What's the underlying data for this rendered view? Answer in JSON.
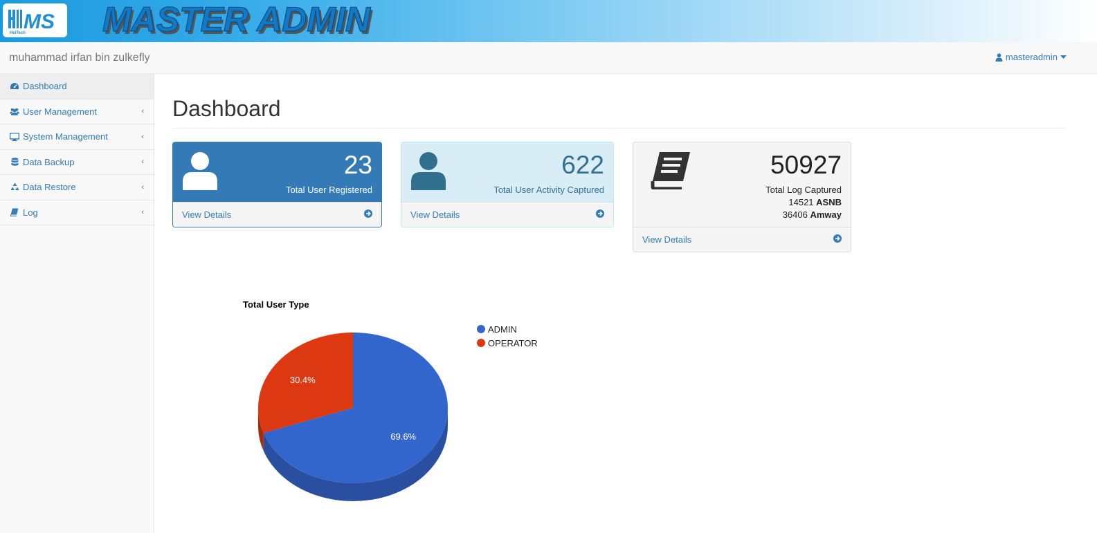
{
  "banner": {
    "title": "MASTER ADMIN",
    "logo_text": "MS",
    "logo_subtext": "HeiTech",
    "logo_icon": "hms-logo"
  },
  "navbar": {
    "brand": "muhammad irfan bin zulkefly",
    "username": "masteradmin",
    "user_icon": "user-icon",
    "caret_icon": "caret-down-icon"
  },
  "sidebar": {
    "items": [
      {
        "label": "Dashboard",
        "icon": "dashboard-icon",
        "active": true
      },
      {
        "label": "User Management",
        "icon": "users-icon"
      },
      {
        "label": "System Management",
        "icon": "desktop-icon"
      },
      {
        "label": "Data Backup",
        "icon": "database-icon"
      },
      {
        "label": "Data Restore",
        "icon": "recycle-icon"
      },
      {
        "label": "Log",
        "icon": "book-icon"
      }
    ]
  },
  "page": {
    "title": "Dashboard"
  },
  "panels": [
    {
      "value": "23",
      "label": "Total User Registered",
      "link": "View Details",
      "icon": "user-icon"
    },
    {
      "value": "622",
      "label": "Total User Activity Captured",
      "link": "View Details",
      "icon": "user-icon"
    },
    {
      "value": "50927",
      "label": "Total Log Captured",
      "line2_num": "14521",
      "line2_name": "ASNB",
      "line3_num": "36406",
      "line3_name": "Amway",
      "link": "View Details",
      "icon": "book-icon"
    }
  ],
  "colors": {
    "primary": "#337ab7",
    "info_bg": "#d9edf7",
    "admin": "#3366cc",
    "operator": "#dc3912"
  },
  "chart_data": {
    "type": "pie",
    "title": "Total User Type",
    "categories": [
      "ADMIN",
      "OPERATOR"
    ],
    "values": [
      69.6,
      30.4
    ],
    "labels": [
      "69.6%",
      "30.4%"
    ],
    "colors": [
      "#3366cc",
      "#dc3912"
    ],
    "is3D": true,
    "legend": "right"
  }
}
